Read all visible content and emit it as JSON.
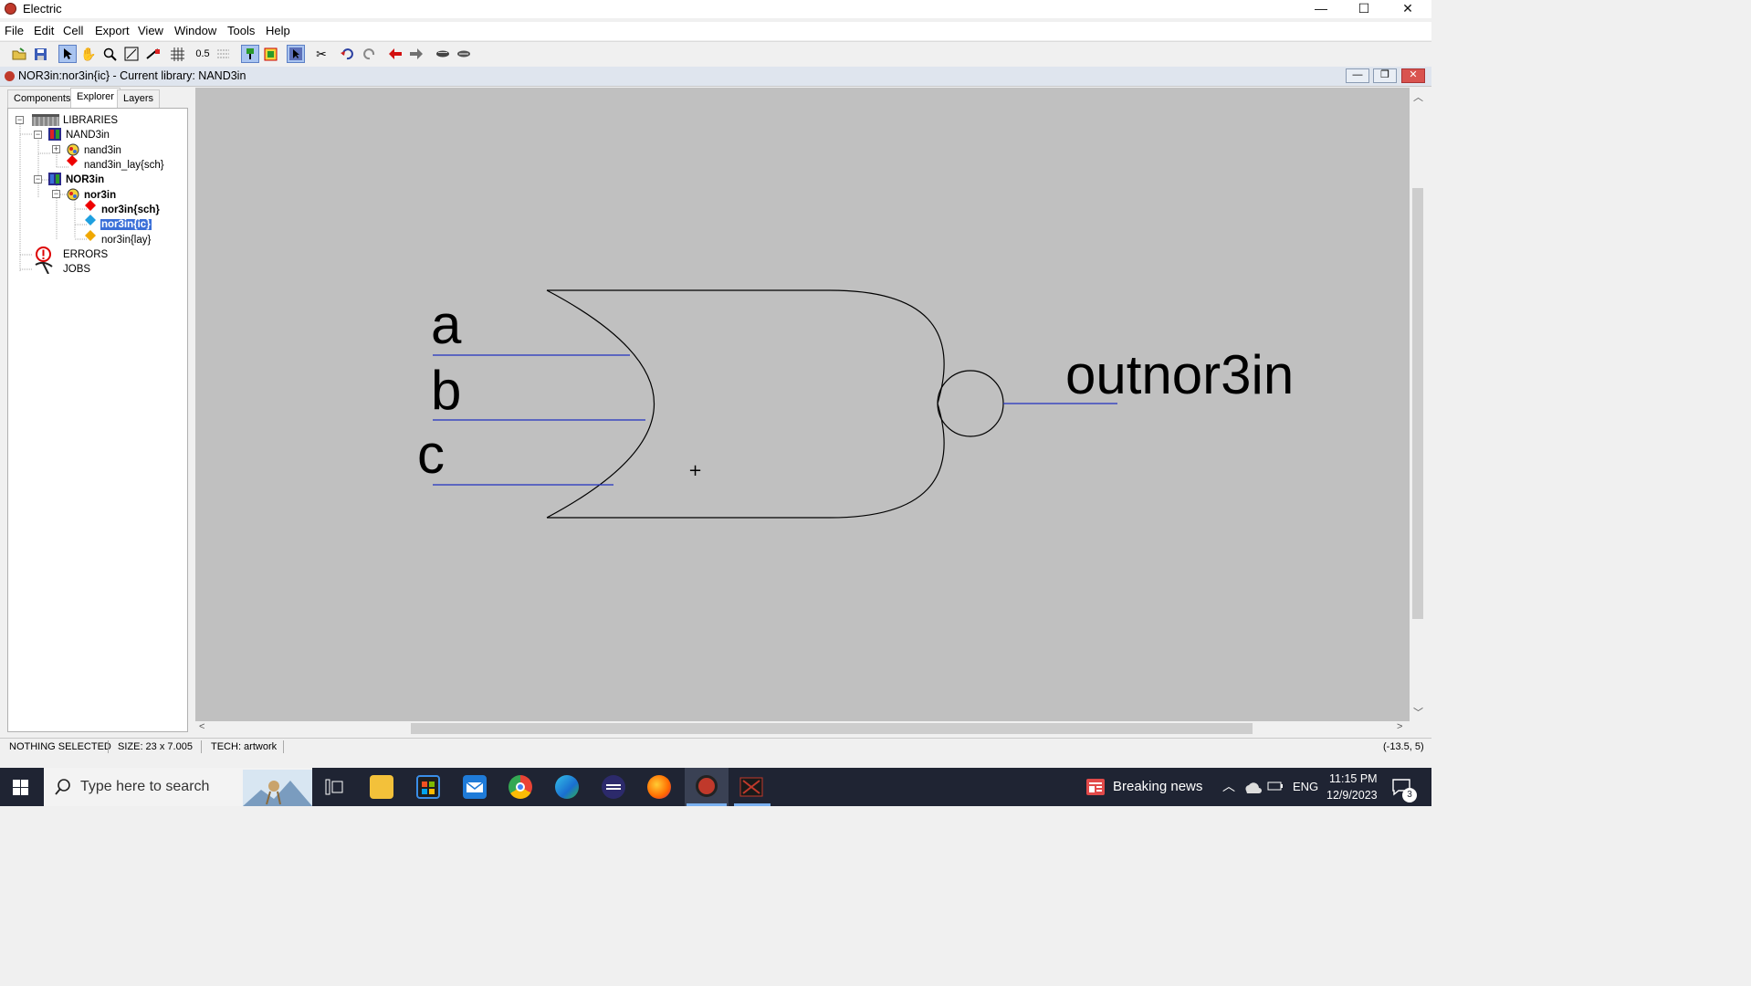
{
  "window": {
    "title": "Electric",
    "min": "—",
    "max": "☐",
    "close": "✕"
  },
  "menu": [
    "File",
    "Edit",
    "Cell",
    "Export",
    "View",
    "Window",
    "Tools",
    "Help"
  ],
  "toolbar": {
    "grid_scale": "0.5"
  },
  "document": {
    "title": "NOR3in:nor3in{ic} - Current library: NAND3in"
  },
  "panel_tabs": [
    "Components",
    "Explorer",
    "Layers"
  ],
  "tree": {
    "libraries": "LIBRARIES",
    "nand3in_lib": "NAND3in",
    "nand3in_cell": "nand3in",
    "nand3in_lay_sch": "nand3in_lay{sch}",
    "nor3in_lib": "NOR3in",
    "nor3in_cell": "nor3in",
    "nor3in_sch": "nor3in{sch}",
    "nor3in_ic": "nor3in{ic}",
    "nor3in_lay": "nor3in{lay}",
    "errors": "ERRORS",
    "jobs": "JOBS"
  },
  "schematic": {
    "inputs": [
      "a",
      "b",
      "c"
    ],
    "output": "outnor3in",
    "cursor": "+"
  },
  "status": {
    "selection": "NOTHING SELECTED",
    "size": "SIZE: 23 x 7.005",
    "tech": "TECH: artwork",
    "coords": "(-13.5, 5)"
  },
  "taskbar": {
    "search_placeholder": "Type here to search",
    "news": "Breaking news",
    "lang": "ENG",
    "time": "11:15 PM",
    "date": "12/9/2023",
    "notifications": "3"
  },
  "colors": {
    "canvas": "#c0c0c0",
    "wire": "#2030c0",
    "selection": "#3a6fd8"
  }
}
